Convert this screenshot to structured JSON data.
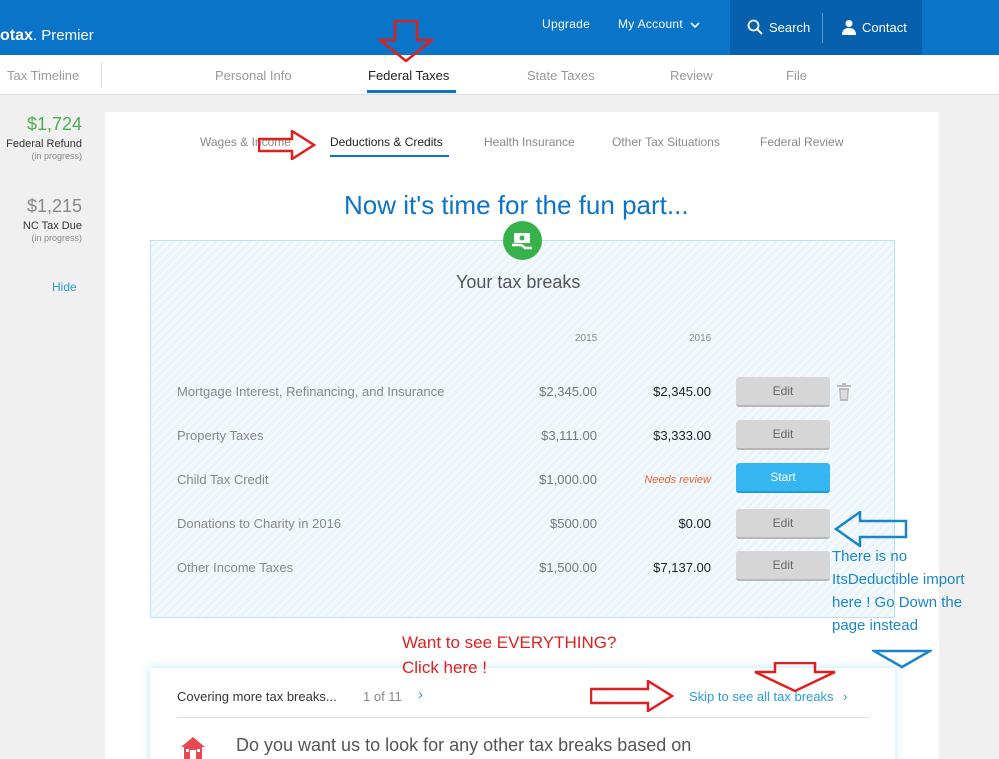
{
  "app": {
    "logo_bold": "otax",
    "logo_suffix": ". Premier"
  },
  "topbar": {
    "upgrade": "Upgrade",
    "my_account": "My Account",
    "search": "Search",
    "contact": "Contact"
  },
  "nav": {
    "tax_timeline": "Tax Timeline",
    "tabs": [
      "Personal Info",
      "Federal Taxes",
      "State Taxes",
      "Review",
      "File"
    ],
    "active": "Federal Taxes"
  },
  "sidebar": {
    "federal": {
      "amount": "$1,724",
      "label": "Federal Refund",
      "status": "(in progress)",
      "color": "#4caf50"
    },
    "state": {
      "amount": "$1,215",
      "label": "NC Tax Due",
      "status": "(in progress)",
      "color": "#888888"
    },
    "hide": "Hide"
  },
  "subtabs": [
    "Wages & Income",
    "Deductions & Credits",
    "Health Insurance",
    "Other Tax Situations",
    "Federal Review"
  ],
  "headline": "Now it's time for the fun part...",
  "breaks": {
    "title": "Your tax breaks",
    "year1": "2015",
    "year2": "2016",
    "rows": [
      {
        "label": "Mortgage Interest, Refinancing, and Insurance",
        "v2015": "$2,345.00",
        "v2016": "$2,345.00",
        "button": "Edit"
      },
      {
        "label": "Property Taxes",
        "v2015": "$3,111.00",
        "v2016": "$3,333.00",
        "button": "Edit"
      },
      {
        "label": "Child Tax Credit",
        "v2015": "$1,000.00",
        "v2016": "Needs review",
        "button": "Start"
      },
      {
        "label": "Donations to Charity in 2016",
        "v2015": "$500.00",
        "v2016": "$0.00",
        "button": "Edit"
      },
      {
        "label": "Other Income Taxes",
        "v2015": "$1,500.00",
        "v2016": "$7,137.00",
        "button": "Edit"
      }
    ]
  },
  "card": {
    "covering": "Covering more tax breaks...",
    "count": "1 of 11",
    "skip": "Skip to see all tax breaks",
    "question": "Do you want us to look for any other tax breaks based on"
  },
  "annotations": {
    "red_line1": "Want to see EVERYTHING?",
    "red_line2": "Click here !",
    "blue_line1": "There is no",
    "blue_line2": "ItsDeductible import",
    "blue_line3": "here !  Go Down the",
    "blue_line4": "page instead"
  },
  "colors": {
    "brand_blue": "#0a74c9",
    "green": "#36b24a",
    "link": "#2a9bd8",
    "annotation_red": "#e02020",
    "annotation_blue": "#1a86c8"
  }
}
